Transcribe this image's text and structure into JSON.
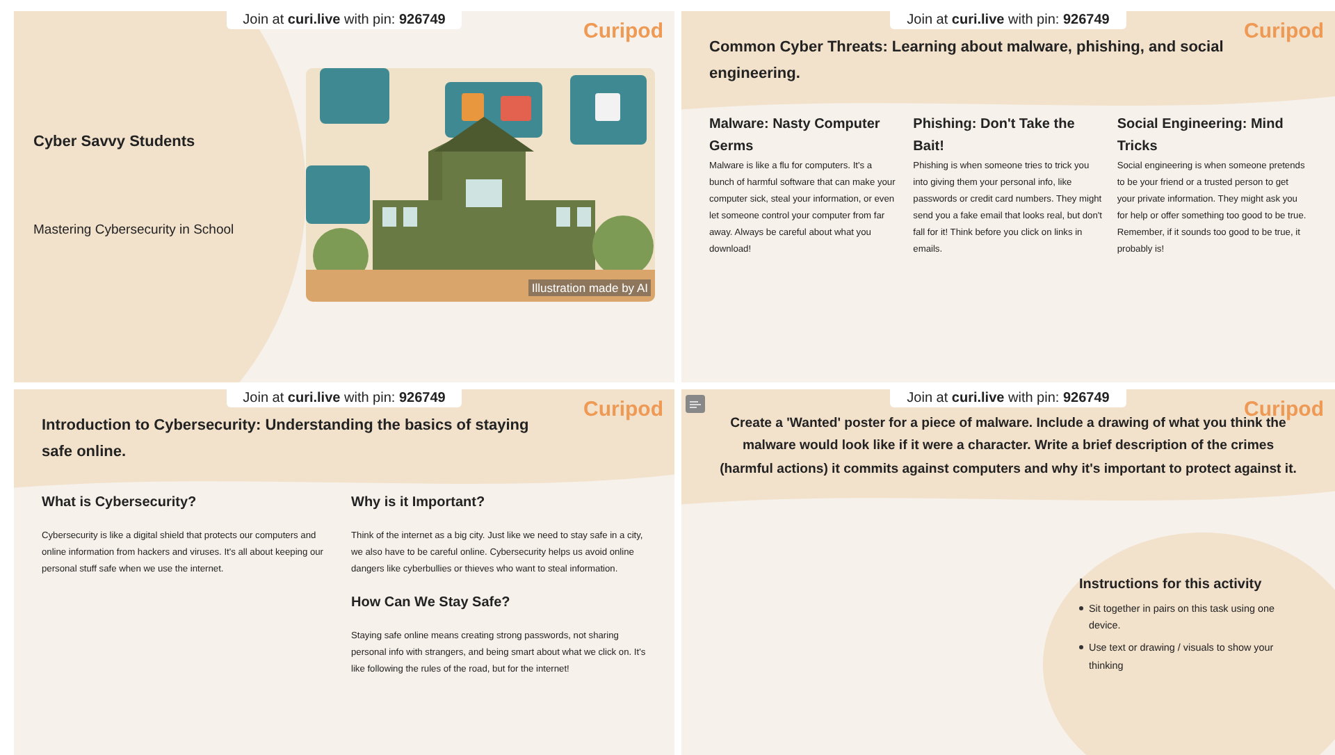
{
  "slides": [
    {
      "kind": "title",
      "join": "Join at **curi.live** with pin: **926749**",
      "logo": "Curipod",
      "title": "Cyber Savvy Students",
      "subtitle": "Mastering Cybersecurity in School",
      "image_caption": "Illustration made by AI"
    },
    {
      "kind": "columns",
      "join": "Join at **curi.live** with pin: **926749**",
      "logo": "Curipod",
      "title": "Common Cyber Threats: Learning about malware, phishing, and social engineering.",
      "columns": [
        {
          "sections": [
            {
              "heading": "Malware: Nasty Computer Germs",
              "body": "Malware is like a flu for computers. It's a bunch of harmful software that can make your computer sick, steal your information, or even let someone control your computer from far away. Always be careful about what you download!"
            }
          ]
        },
        {
          "sections": [
            {
              "heading": "Phishing: Don't Take the Bait!",
              "body": "Phishing is when someone tries to trick you into giving them your personal info, like passwords or credit card numbers. They might send you a fake email that looks real, but don't fall for it! Think before you click on links in emails."
            }
          ]
        },
        {
          "sections": [
            {
              "heading": "Social Engineering: Mind Tricks",
              "body": "Social engineering is when someone pretends to be your friend or a trusted person to get your private information. They might ask you for help or offer something too good to be true. Remember, if it sounds too good to be true, it probably is!"
            }
          ]
        }
      ]
    },
    {
      "kind": "columns",
      "join": "Join at **curi.live** with pin: **926749**",
      "logo": "Curipod",
      "title": "Introduction to Cybersecurity: Understanding the basics of staying safe online.",
      "columns": [
        {
          "sections": [
            {
              "heading": "What is Cybersecurity?",
              "body": "Cybersecurity is like a digital shield that protects our computers and online information from hackers and viruses. It's all about keeping our personal stuff safe when we use the internet."
            }
          ]
        },
        {
          "sections": [
            {
              "heading": "Why is it Important?",
              "body": "Think of the internet as a big city. Just like we need to stay safe in a city, we also have to be careful online. Cybersecurity helps us avoid online dangers like cyberbullies or thieves who want to steal information."
            },
            {
              "heading": "How Can We Stay Safe?",
              "body": "Staying safe online means creating strong passwords, not sharing personal info with strangers, and being smart about what we click on. It's like following the rules of the road, but for the internet!"
            }
          ]
        }
      ]
    },
    {
      "kind": "activity",
      "join": "Join at **curi.live** with pin: **926749**",
      "logo": "Curipod",
      "prompt": "Create a 'Wanted' poster for a piece of malware. Include a drawing of what you think the malware would look like if it were a character. Write a brief description of the crimes (harmful actions) it commits against computers and why it's important to protect against it.",
      "instructions": {
        "heading": "Instructions for this activity",
        "items": [
          "Sit together in pairs on this task using one device.",
          "Use text or drawing / visuals to show your thinking"
        ]
      }
    }
  ]
}
